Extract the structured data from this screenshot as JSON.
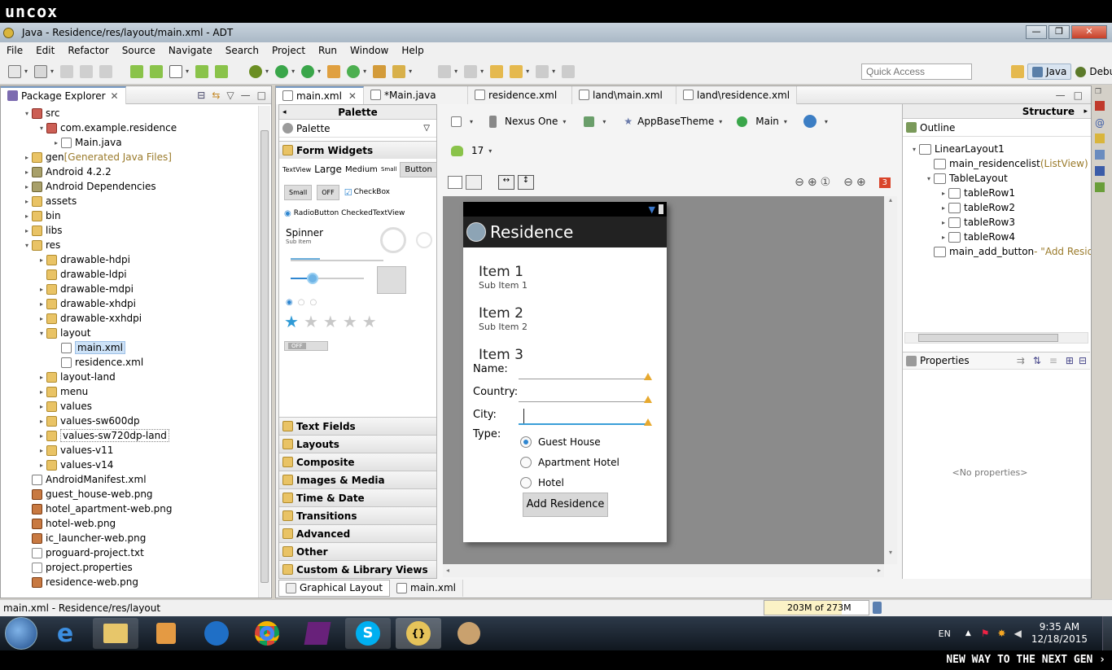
{
  "brand_top": "uncox",
  "window": {
    "title": "Java - Residence/res/layout/main.xml - ADT",
    "buttons": [
      "—",
      "❐",
      "✕"
    ]
  },
  "menu": [
    "File",
    "Edit",
    "Refactor",
    "Source",
    "Navigate",
    "Search",
    "Project",
    "Run",
    "Window",
    "Help"
  ],
  "quick_access": {
    "placeholder": "Quick Access"
  },
  "perspectives": {
    "java": "Java",
    "debug": "Debug"
  },
  "package_explorer": {
    "tab": "Package Explorer",
    "tree": [
      {
        "indent": 1,
        "arrow": "▾",
        "icon": "pkg",
        "label": "src"
      },
      {
        "indent": 2,
        "arrow": "▾",
        "icon": "pkg",
        "label": "com.example.residence"
      },
      {
        "indent": 3,
        "arrow": "▸",
        "icon": "jfile",
        "label": "Main.java"
      },
      {
        "indent": 1,
        "arrow": "▸",
        "icon": "folder",
        "label": "gen",
        "suffix": " [Generated Java Files]"
      },
      {
        "indent": 1,
        "arrow": "▸",
        "icon": "jar",
        "label": "Android 4.2.2"
      },
      {
        "indent": 1,
        "arrow": "▸",
        "icon": "jar",
        "label": "Android Dependencies"
      },
      {
        "indent": 1,
        "arrow": "▸",
        "icon": "folder",
        "label": "assets"
      },
      {
        "indent": 1,
        "arrow": "▸",
        "icon": "folder",
        "label": "bin"
      },
      {
        "indent": 1,
        "arrow": "▸",
        "icon": "folder",
        "label": "libs"
      },
      {
        "indent": 1,
        "arrow": "▾",
        "icon": "folder",
        "label": "res"
      },
      {
        "indent": 2,
        "arrow": "▸",
        "icon": "folder",
        "label": "drawable-hdpi"
      },
      {
        "indent": 2,
        "arrow": "",
        "icon": "folder",
        "label": "drawable-ldpi"
      },
      {
        "indent": 2,
        "arrow": "▸",
        "icon": "folder",
        "label": "drawable-mdpi"
      },
      {
        "indent": 2,
        "arrow": "▸",
        "icon": "folder",
        "label": "drawable-xhdpi"
      },
      {
        "indent": 2,
        "arrow": "▸",
        "icon": "folder",
        "label": "drawable-xxhdpi"
      },
      {
        "indent": 2,
        "arrow": "▾",
        "icon": "folder",
        "label": "layout"
      },
      {
        "indent": 3,
        "arrow": "",
        "icon": "xml",
        "label": "main.xml",
        "selected": true
      },
      {
        "indent": 3,
        "arrow": "",
        "icon": "xml",
        "label": "residence.xml"
      },
      {
        "indent": 2,
        "arrow": "▸",
        "icon": "folder",
        "label": "layout-land"
      },
      {
        "indent": 2,
        "arrow": "▸",
        "icon": "folder",
        "label": "menu"
      },
      {
        "indent": 2,
        "arrow": "▸",
        "icon": "folder",
        "label": "values"
      },
      {
        "indent": 2,
        "arrow": "▸",
        "icon": "folder",
        "label": "values-sw600dp"
      },
      {
        "indent": 2,
        "arrow": "▸",
        "icon": "folder",
        "label": "values-sw720dp-land",
        "boxed": true
      },
      {
        "indent": 2,
        "arrow": "▸",
        "icon": "folder",
        "label": "values-v11"
      },
      {
        "indent": 2,
        "arrow": "▸",
        "icon": "folder",
        "label": "values-v14"
      },
      {
        "indent": 1,
        "arrow": "",
        "icon": "xml",
        "label": "AndroidManifest.xml"
      },
      {
        "indent": 1,
        "arrow": "",
        "icon": "png",
        "label": "guest_house-web.png"
      },
      {
        "indent": 1,
        "arrow": "",
        "icon": "png",
        "label": "hotel_apartment-web.png"
      },
      {
        "indent": 1,
        "arrow": "",
        "icon": "png",
        "label": "hotel-web.png"
      },
      {
        "indent": 1,
        "arrow": "",
        "icon": "png",
        "label": "ic_launcher-web.png"
      },
      {
        "indent": 1,
        "arrow": "",
        "icon": "txt",
        "label": "proguard-project.txt"
      },
      {
        "indent": 1,
        "arrow": "",
        "icon": "txt",
        "label": "project.properties"
      },
      {
        "indent": 1,
        "arrow": "",
        "icon": "png",
        "label": "residence-web.png"
      }
    ]
  },
  "editor_tabs": [
    {
      "label": "main.xml",
      "active": true,
      "close": true
    },
    {
      "label": "*Main.java"
    },
    {
      "label": "residence.xml"
    },
    {
      "label": "land\\main.xml"
    },
    {
      "label": "land\\residence.xml"
    }
  ],
  "palette": {
    "header": "Palette",
    "dropdown": "Palette",
    "form_widgets": "Form Widgets",
    "textviews": {
      "tv": "TextView",
      "large": "Large",
      "medium": "Medium",
      "small": "Small",
      "button": "Button"
    },
    "row2": {
      "small_btn": "Small",
      "toggle": "OFF",
      "checkbox": "CheckBox"
    },
    "row3": {
      "radio": "RadioButton",
      "checked": "CheckedTextView"
    },
    "spinner": {
      "title": "Spinner",
      "sub": "Sub Item"
    },
    "switch": "OFF",
    "sections": [
      "Text Fields",
      "Layouts",
      "Composite",
      "Images & Media",
      "Time & Date",
      "Transitions",
      "Advanced",
      "Other",
      "Custom & Library Views"
    ]
  },
  "canvas_toolbar": {
    "device": "Nexus One",
    "theme": "AppBaseTheme",
    "activity": "Main",
    "api": "17",
    "error_count": "3"
  },
  "device_preview": {
    "app_title": "Residence",
    "items": [
      {
        "title": "Item 1",
        "sub": "Sub Item 1"
      },
      {
        "title": "Item 2",
        "sub": "Sub Item 2"
      },
      {
        "title": "Item 3",
        "sub": ""
      }
    ],
    "fields": [
      {
        "label": "Name:"
      },
      {
        "label": "Country:"
      },
      {
        "label": "City:"
      }
    ],
    "type_label": "Type:",
    "radios": [
      {
        "label": "Guest House",
        "checked": true
      },
      {
        "label": "Apartment Hotel",
        "checked": false
      },
      {
        "label": "Hotel",
        "checked": false
      }
    ],
    "add_button": "Add Residence"
  },
  "bottom_tabs": {
    "graphical": "Graphical Layout",
    "xml": "main.xml"
  },
  "structure": {
    "header": "Structure",
    "outline": "Outline",
    "tree": [
      {
        "indent": 0,
        "arrow": "▾",
        "label": "LinearLayout1",
        "extra": ""
      },
      {
        "indent": 1,
        "arrow": "",
        "label": "main_residencelist",
        "extra": " (ListView)"
      },
      {
        "indent": 1,
        "arrow": "▾",
        "label": "TableLayout",
        "extra": ""
      },
      {
        "indent": 2,
        "arrow": "▸",
        "label": "tableRow1",
        "extra": ""
      },
      {
        "indent": 2,
        "arrow": "▸",
        "label": "tableRow2",
        "extra": ""
      },
      {
        "indent": 2,
        "arrow": "▸",
        "label": "tableRow3",
        "extra": ""
      },
      {
        "indent": 2,
        "arrow": "▸",
        "label": "tableRow4",
        "extra": ""
      },
      {
        "indent": 1,
        "arrow": "",
        "label": "main_add_button",
        "extra": " - \"Add Reside"
      }
    ],
    "properties": "Properties",
    "no_props": "<No properties>"
  },
  "statusbar": {
    "path": "main.xml - Residence/res/layout",
    "memory": "203M of 273M",
    "memory_used_fraction": 0.74
  },
  "tray": {
    "lang": "EN",
    "time": "9:35 AM",
    "date": "12/18/2015"
  },
  "brand_bottom": "NEW WAY TO THE NEXT GEN ›",
  "colors": {
    "accent": "#2f86d0",
    "android_green": "#8ac34a",
    "warn": "#e7a92f"
  }
}
